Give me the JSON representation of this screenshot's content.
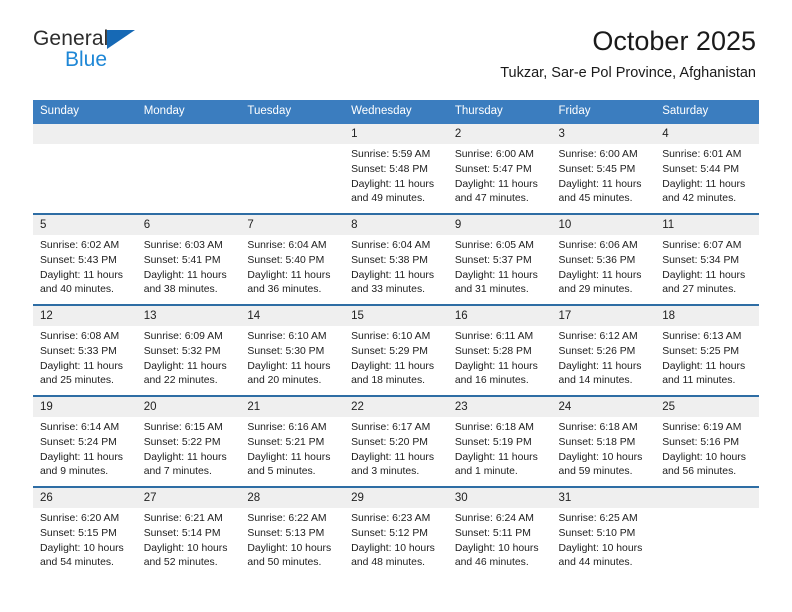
{
  "brand": {
    "word_one": "General",
    "word_two": "Blue",
    "triangle_icon": "triangle-icon"
  },
  "header": {
    "title": "October 2025",
    "subtitle": "Tukzar, Sar-e Pol Province, Afghanistan"
  },
  "colors": {
    "header_bar": "#3b7dbf",
    "row_divider": "#2e6da4",
    "daynum_bg": "#efefef",
    "brand_blue": "#1e87d6",
    "brand_triangle": "#1669b5"
  },
  "weekdays": [
    "Sunday",
    "Monday",
    "Tuesday",
    "Wednesday",
    "Thursday",
    "Friday",
    "Saturday"
  ],
  "weeks": [
    [
      {
        "day": "",
        "sunrise": "",
        "sunset": "",
        "daylight": "",
        "empty": true
      },
      {
        "day": "",
        "sunrise": "",
        "sunset": "",
        "daylight": "",
        "empty": true
      },
      {
        "day": "",
        "sunrise": "",
        "sunset": "",
        "daylight": "",
        "empty": true
      },
      {
        "day": "1",
        "sunrise": "Sunrise: 5:59 AM",
        "sunset": "Sunset: 5:48 PM",
        "daylight": "Daylight: 11 hours and 49 minutes."
      },
      {
        "day": "2",
        "sunrise": "Sunrise: 6:00 AM",
        "sunset": "Sunset: 5:47 PM",
        "daylight": "Daylight: 11 hours and 47 minutes."
      },
      {
        "day": "3",
        "sunrise": "Sunrise: 6:00 AM",
        "sunset": "Sunset: 5:45 PM",
        "daylight": "Daylight: 11 hours and 45 minutes."
      },
      {
        "day": "4",
        "sunrise": "Sunrise: 6:01 AM",
        "sunset": "Sunset: 5:44 PM",
        "daylight": "Daylight: 11 hours and 42 minutes."
      }
    ],
    [
      {
        "day": "5",
        "sunrise": "Sunrise: 6:02 AM",
        "sunset": "Sunset: 5:43 PM",
        "daylight": "Daylight: 11 hours and 40 minutes."
      },
      {
        "day": "6",
        "sunrise": "Sunrise: 6:03 AM",
        "sunset": "Sunset: 5:41 PM",
        "daylight": "Daylight: 11 hours and 38 minutes."
      },
      {
        "day": "7",
        "sunrise": "Sunrise: 6:04 AM",
        "sunset": "Sunset: 5:40 PM",
        "daylight": "Daylight: 11 hours and 36 minutes."
      },
      {
        "day": "8",
        "sunrise": "Sunrise: 6:04 AM",
        "sunset": "Sunset: 5:38 PM",
        "daylight": "Daylight: 11 hours and 33 minutes."
      },
      {
        "day": "9",
        "sunrise": "Sunrise: 6:05 AM",
        "sunset": "Sunset: 5:37 PM",
        "daylight": "Daylight: 11 hours and 31 minutes."
      },
      {
        "day": "10",
        "sunrise": "Sunrise: 6:06 AM",
        "sunset": "Sunset: 5:36 PM",
        "daylight": "Daylight: 11 hours and 29 minutes."
      },
      {
        "day": "11",
        "sunrise": "Sunrise: 6:07 AM",
        "sunset": "Sunset: 5:34 PM",
        "daylight": "Daylight: 11 hours and 27 minutes."
      }
    ],
    [
      {
        "day": "12",
        "sunrise": "Sunrise: 6:08 AM",
        "sunset": "Sunset: 5:33 PM",
        "daylight": "Daylight: 11 hours and 25 minutes."
      },
      {
        "day": "13",
        "sunrise": "Sunrise: 6:09 AM",
        "sunset": "Sunset: 5:32 PM",
        "daylight": "Daylight: 11 hours and 22 minutes."
      },
      {
        "day": "14",
        "sunrise": "Sunrise: 6:10 AM",
        "sunset": "Sunset: 5:30 PM",
        "daylight": "Daylight: 11 hours and 20 minutes."
      },
      {
        "day": "15",
        "sunrise": "Sunrise: 6:10 AM",
        "sunset": "Sunset: 5:29 PM",
        "daylight": "Daylight: 11 hours and 18 minutes."
      },
      {
        "day": "16",
        "sunrise": "Sunrise: 6:11 AM",
        "sunset": "Sunset: 5:28 PM",
        "daylight": "Daylight: 11 hours and 16 minutes."
      },
      {
        "day": "17",
        "sunrise": "Sunrise: 6:12 AM",
        "sunset": "Sunset: 5:26 PM",
        "daylight": "Daylight: 11 hours and 14 minutes."
      },
      {
        "day": "18",
        "sunrise": "Sunrise: 6:13 AM",
        "sunset": "Sunset: 5:25 PM",
        "daylight": "Daylight: 11 hours and 11 minutes."
      }
    ],
    [
      {
        "day": "19",
        "sunrise": "Sunrise: 6:14 AM",
        "sunset": "Sunset: 5:24 PM",
        "daylight": "Daylight: 11 hours and 9 minutes."
      },
      {
        "day": "20",
        "sunrise": "Sunrise: 6:15 AM",
        "sunset": "Sunset: 5:22 PM",
        "daylight": "Daylight: 11 hours and 7 minutes."
      },
      {
        "day": "21",
        "sunrise": "Sunrise: 6:16 AM",
        "sunset": "Sunset: 5:21 PM",
        "daylight": "Daylight: 11 hours and 5 minutes."
      },
      {
        "day": "22",
        "sunrise": "Sunrise: 6:17 AM",
        "sunset": "Sunset: 5:20 PM",
        "daylight": "Daylight: 11 hours and 3 minutes."
      },
      {
        "day": "23",
        "sunrise": "Sunrise: 6:18 AM",
        "sunset": "Sunset: 5:19 PM",
        "daylight": "Daylight: 11 hours and 1 minute."
      },
      {
        "day": "24",
        "sunrise": "Sunrise: 6:18 AM",
        "sunset": "Sunset: 5:18 PM",
        "daylight": "Daylight: 10 hours and 59 minutes."
      },
      {
        "day": "25",
        "sunrise": "Sunrise: 6:19 AM",
        "sunset": "Sunset: 5:16 PM",
        "daylight": "Daylight: 10 hours and 56 minutes."
      }
    ],
    [
      {
        "day": "26",
        "sunrise": "Sunrise: 6:20 AM",
        "sunset": "Sunset: 5:15 PM",
        "daylight": "Daylight: 10 hours and 54 minutes."
      },
      {
        "day": "27",
        "sunrise": "Sunrise: 6:21 AM",
        "sunset": "Sunset: 5:14 PM",
        "daylight": "Daylight: 10 hours and 52 minutes."
      },
      {
        "day": "28",
        "sunrise": "Sunrise: 6:22 AM",
        "sunset": "Sunset: 5:13 PM",
        "daylight": "Daylight: 10 hours and 50 minutes."
      },
      {
        "day": "29",
        "sunrise": "Sunrise: 6:23 AM",
        "sunset": "Sunset: 5:12 PM",
        "daylight": "Daylight: 10 hours and 48 minutes."
      },
      {
        "day": "30",
        "sunrise": "Sunrise: 6:24 AM",
        "sunset": "Sunset: 5:11 PM",
        "daylight": "Daylight: 10 hours and 46 minutes."
      },
      {
        "day": "31",
        "sunrise": "Sunrise: 6:25 AM",
        "sunset": "Sunset: 5:10 PM",
        "daylight": "Daylight: 10 hours and 44 minutes."
      },
      {
        "day": "",
        "sunrise": "",
        "sunset": "",
        "daylight": "",
        "empty": true
      }
    ]
  ]
}
